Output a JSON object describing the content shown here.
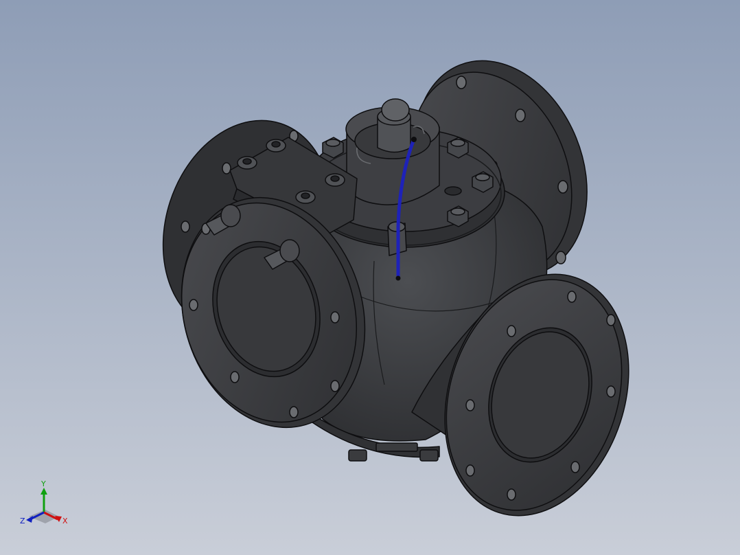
{
  "viewport": {
    "background_top": "#8e9db6",
    "background_bottom": "#c9ced8"
  },
  "model": {
    "body_color": "#3a3b3e",
    "edge_color": "#0e0e10",
    "highlight_color": "#55575b",
    "tube_color": "#1e22b8"
  },
  "triad": {
    "x_label": "X",
    "y_label": "Y",
    "z_label": "Z",
    "x_color": "#d01010",
    "y_color": "#10a010",
    "z_color": "#1020c0"
  }
}
